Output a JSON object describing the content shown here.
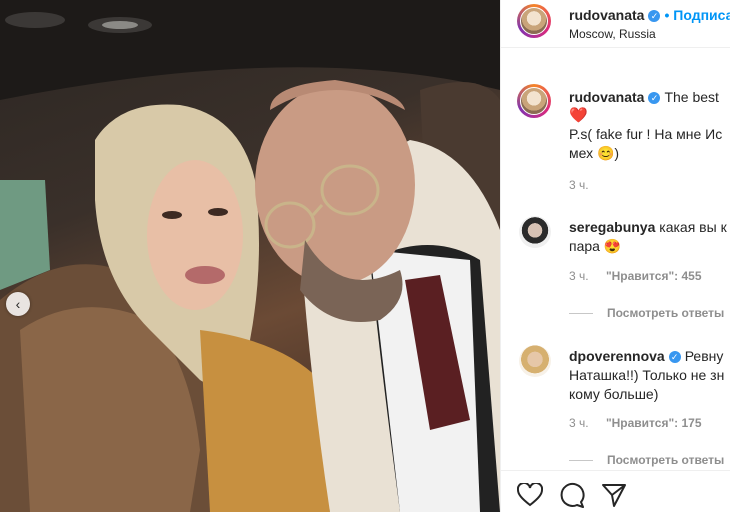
{
  "post": {
    "author": "rudovanata",
    "location": "Moscow, Russia",
    "follow_label": "• Подписаться",
    "caption_line1": "The best",
    "caption_heart": "❤️",
    "caption_line2": "P.s( fake fur ! На мне Ис",
    "caption_line3": "мех 😊)",
    "time": "3 ч."
  },
  "comments": [
    {
      "username": "seregabunya",
      "text_line1": "какая вы к",
      "text_line2": "пара 😍",
      "time": "3 ч.",
      "likes": "\"Нравится\": 455",
      "replies_label": "Посмотреть ответы"
    },
    {
      "username": "dpoverennova",
      "text_line1": "Ревну",
      "text_line2": "Наташка!!) Только не зн",
      "text_line3": "кому больше)",
      "time": "3 ч.",
      "likes": "\"Нравится\": 175",
      "replies_label": "Посмотреть ответы"
    }
  ],
  "icons": [
    "heart-icon",
    "comment-icon",
    "share-icon",
    "verified-badge-icon",
    "chevron-left-icon"
  ],
  "colors": {
    "link": "#0095f6",
    "verified": "#3897f0",
    "muted": "#8e8e8e"
  }
}
